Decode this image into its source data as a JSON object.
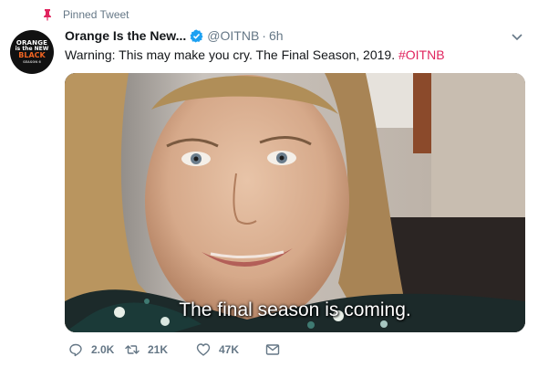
{
  "pinned": {
    "label": "Pinned Tweet",
    "icon": "pin-icon",
    "icon_color": "#e0245e"
  },
  "avatar": {
    "line1": "ORANGE",
    "line2": "is the NEW",
    "line3": "BLACK",
    "line4": "SEASON 6"
  },
  "tweet": {
    "display_name": "Orange Is the New...",
    "handle": "@OITNB",
    "separator": "·",
    "time": "6h",
    "text": "Warning: This may make you cry. The Final Season, 2019. ",
    "hashtag": "#OITNB"
  },
  "media": {
    "subtitle": "The final season is coming."
  },
  "actions": {
    "reply_count": "2.0K",
    "retweet_count": "21K",
    "like_count": "47K"
  },
  "colors": {
    "hashtag": "#e0245e",
    "secondary_text": "#657786",
    "verified": "#1da1f2"
  }
}
